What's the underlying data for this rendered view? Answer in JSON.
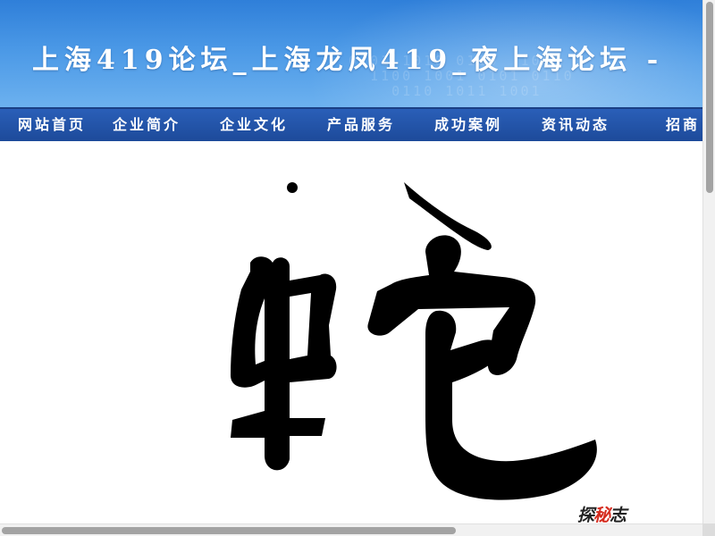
{
  "header": {
    "title": "上海419论坛_上海龙凤419_夜上海论坛 -",
    "background_color": "#3d8fe2"
  },
  "nav": {
    "background_color": "#2456ab",
    "items": [
      {
        "label": "网站首页"
      },
      {
        "label": "企业简介"
      },
      {
        "label": "企业文化"
      },
      {
        "label": "产品服务"
      },
      {
        "label": "成功案例"
      },
      {
        "label": "资讯动态"
      },
      {
        "label": "招商"
      }
    ]
  },
  "content": {
    "image": {
      "glyph": "蛇",
      "watermark": {
        "left": "探",
        "middle": "秘",
        "right": "志"
      },
      "watermark_color": "#d52b1e"
    }
  }
}
